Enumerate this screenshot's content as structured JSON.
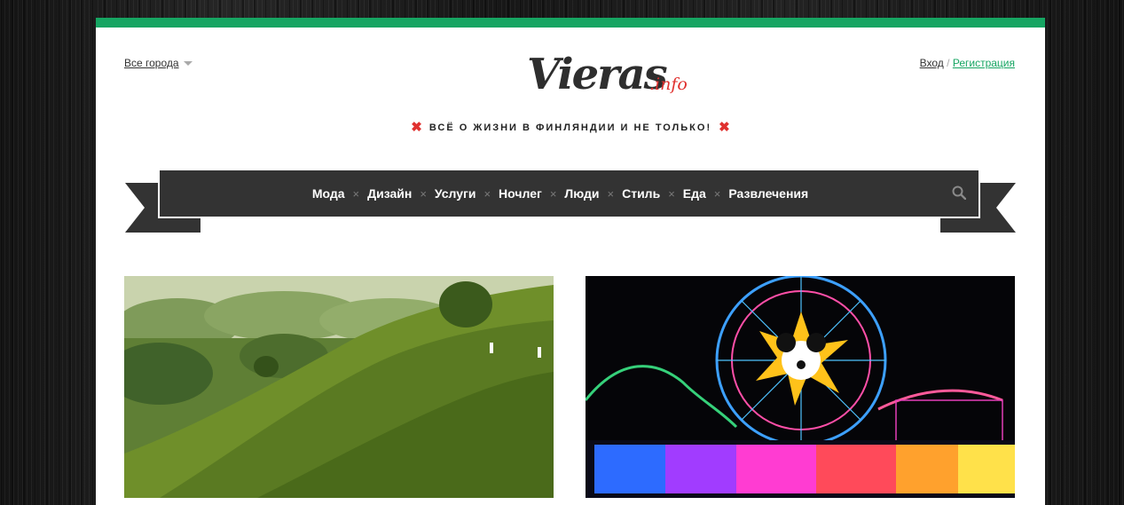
{
  "header": {
    "city_select": "Все города",
    "login": "Вход",
    "separator": "/",
    "register": "Регистрация",
    "logo_word": "Vieras",
    "logo_tld": ".info",
    "tagline": "ВСЁ О ЖИЗНИ В ФИНЛЯНДИИ И НЕ ТОЛЬКО!"
  },
  "nav": {
    "items": [
      "Мода",
      "Дизайн",
      "Услуги",
      "Ночлег",
      "Люди",
      "Стиль",
      "Еда",
      "Развлечения"
    ],
    "separator": "×",
    "search_icon": "search-icon"
  },
  "colors": {
    "accent": "#16a562",
    "brand_red": "#e0312f",
    "nav_bg": "#333333"
  }
}
